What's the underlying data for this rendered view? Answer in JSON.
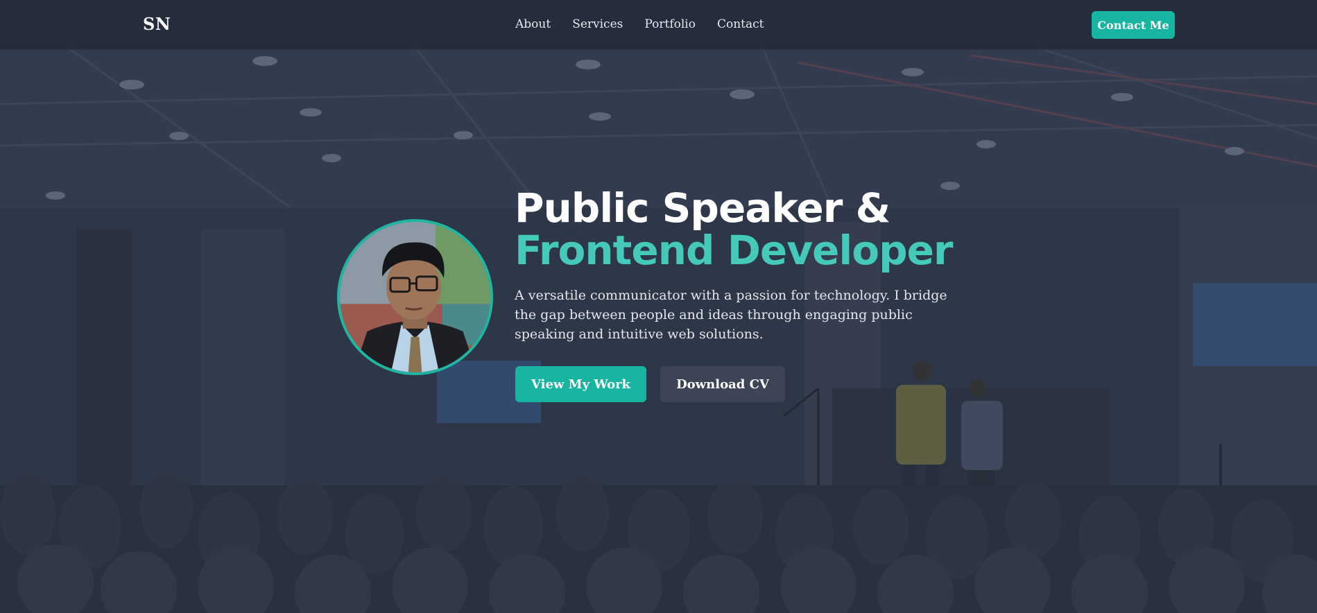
{
  "nav": {
    "logo": "SN",
    "links": [
      "About",
      "Services",
      "Portfolio",
      "Contact"
    ],
    "cta_label": "Contact Me"
  },
  "hero": {
    "title_line1": "Public Speaker &",
    "title_line2": "Frontend Developer",
    "description": "A versatile communicator with a passion for technology. I bridge the gap between people and ideas through engaging public speaking and intuitive web solutions.",
    "primary_button": "View My Work",
    "secondary_button": "Download CV",
    "avatar_alt": "profile-photo"
  },
  "colors": {
    "accent": "#17b5a1",
    "accent_text": "#45c9b8",
    "nav_bg": "#242c3c",
    "page_bg": "#2b3445",
    "secondary_button": "#3c4456"
  }
}
